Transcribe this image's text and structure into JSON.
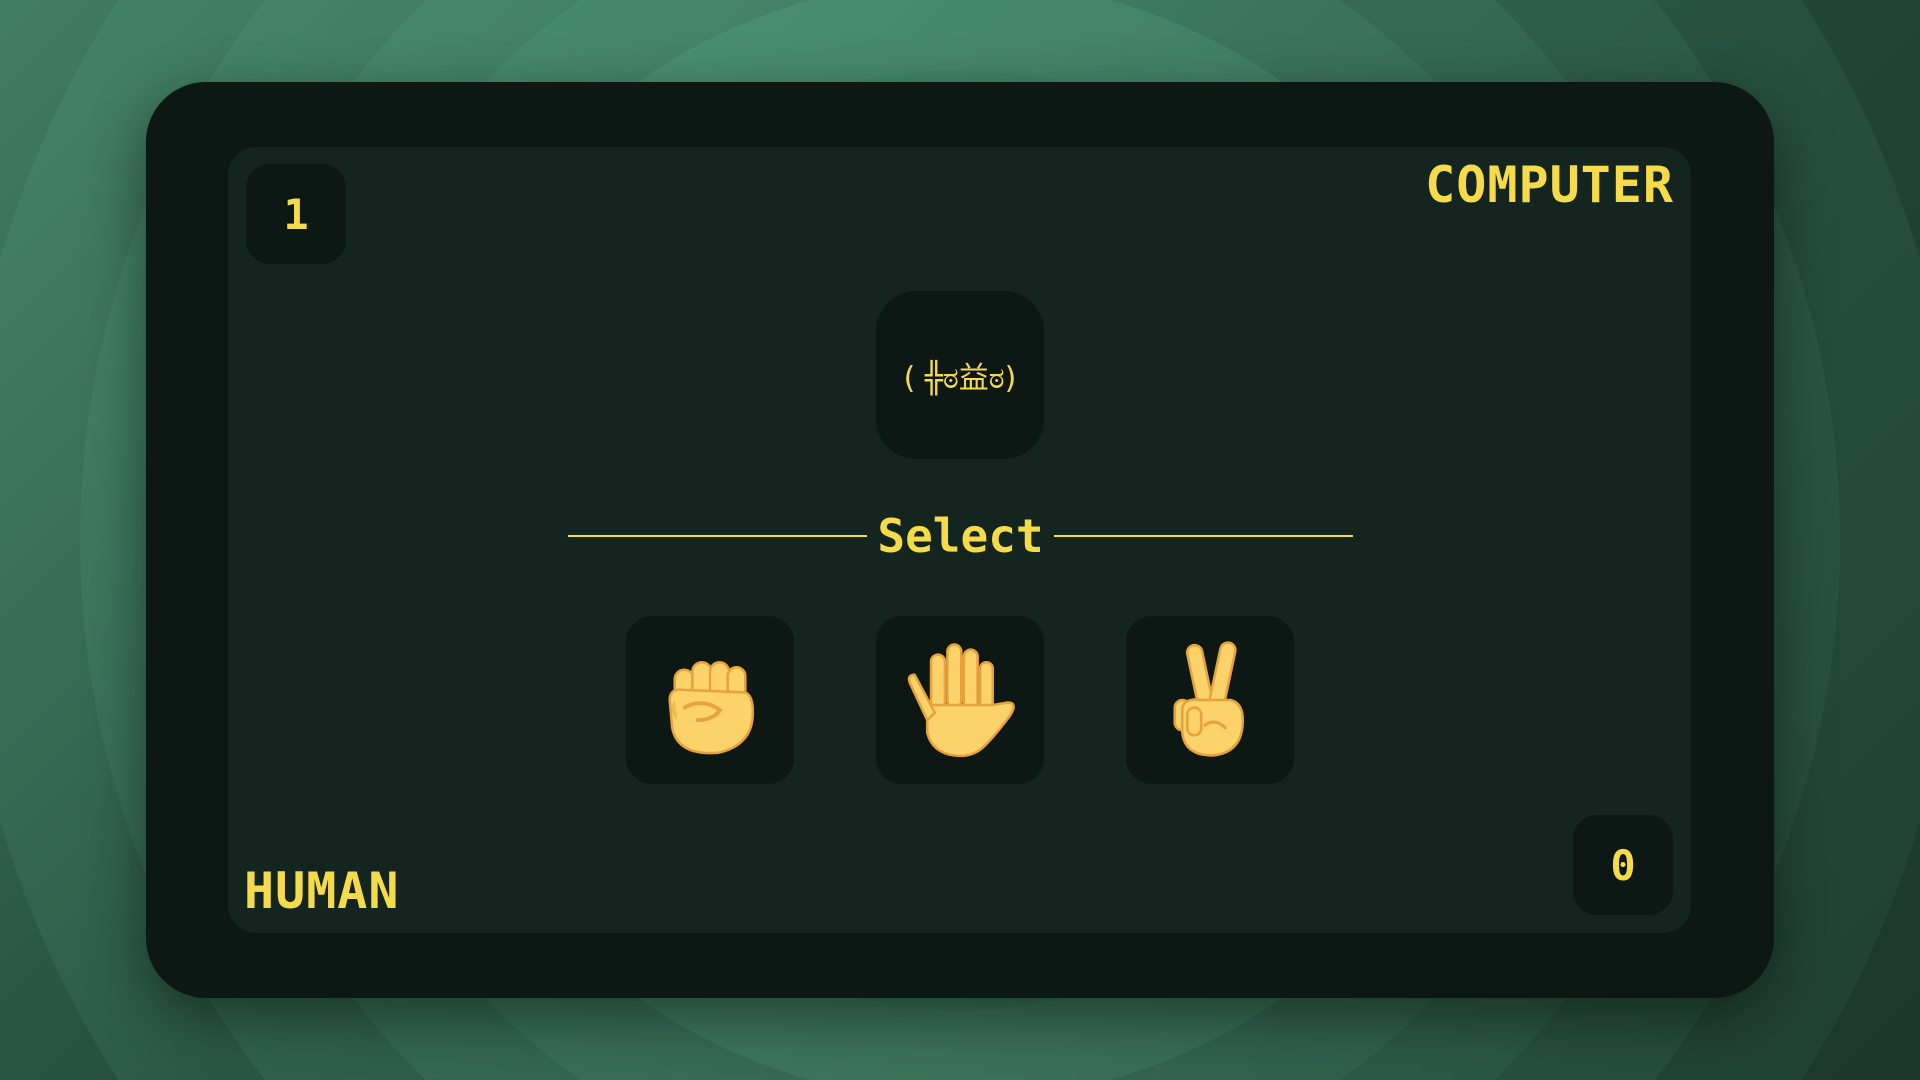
{
  "computer": {
    "label": "COMPUTER",
    "score": "1"
  },
  "human": {
    "label": "HUMAN",
    "score": "0"
  },
  "computer_face": "( ╬ಠ益ಠ)",
  "prompt": "Select",
  "choices": [
    {
      "name": "rock",
      "icon": "raised-fist-icon"
    },
    {
      "name": "paper",
      "icon": "raised-hand-icon"
    },
    {
      "name": "scissors",
      "icon": "victory-hand-icon"
    }
  ],
  "colors": {
    "accent": "#f5db4a",
    "panel": "#0d1714",
    "board": "#142520",
    "skin": "#fcd26b",
    "skin_shade": "#e8a23c"
  }
}
